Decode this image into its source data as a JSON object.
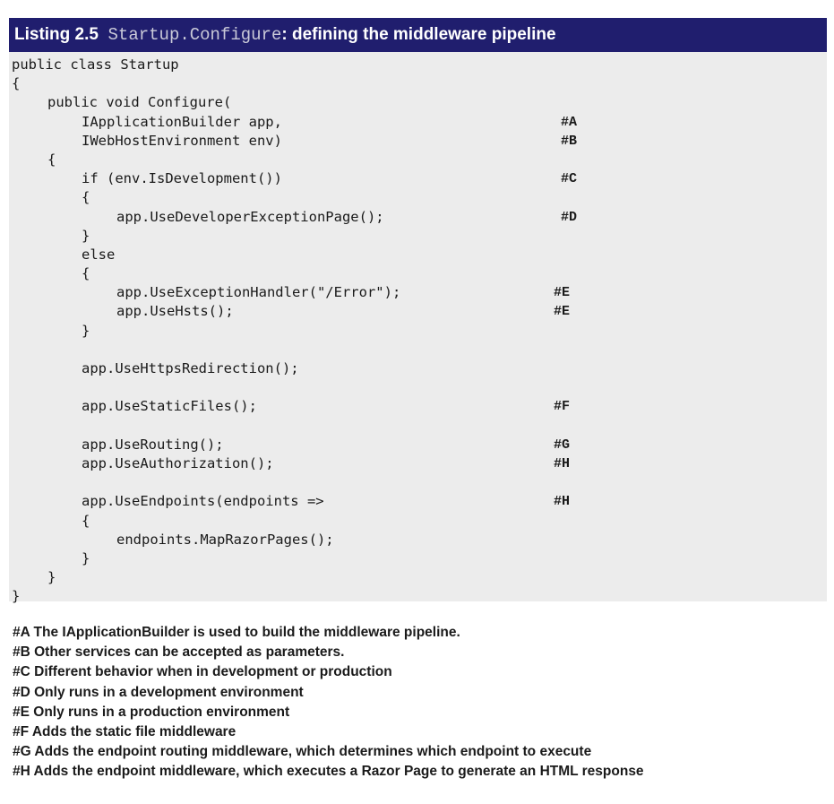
{
  "listing": {
    "label": "Listing 2.5",
    "code_name": "Startup.Configure",
    "title_rest": ": defining the middleware pipeline"
  },
  "code_lines": [
    {
      "text": "public class Startup",
      "annot": ""
    },
    {
      "text": "{",
      "annot": ""
    },
    {
      "text": "public void Configure(",
      "annot": ""
    },
    {
      "text": "IApplicationBuilder app,",
      "annot": "#A"
    },
    {
      "text": "IWebHostEnvironment env)",
      "annot": "#B"
    },
    {
      "text": "{",
      "annot": ""
    },
    {
      "text": "if (env.IsDevelopment())",
      "annot": "#C"
    },
    {
      "text": "{",
      "annot": ""
    },
    {
      "text": "app.UseDeveloperExceptionPage();",
      "annot": "#D"
    },
    {
      "text": "}",
      "annot": ""
    },
    {
      "text": "else",
      "annot": ""
    },
    {
      "text": "{",
      "annot": ""
    },
    {
      "text": "app.UseExceptionHandler(\"/Error\");",
      "annot": "#E"
    },
    {
      "text": "app.UseHsts();",
      "annot": "#E"
    },
    {
      "text": "}",
      "annot": ""
    },
    {
      "text": "",
      "annot": ""
    },
    {
      "text": "app.UseHttpsRedirection();",
      "annot": ""
    },
    {
      "text": "",
      "annot": ""
    },
    {
      "text": "app.UseStaticFiles();",
      "annot": "#F"
    },
    {
      "text": "",
      "annot": ""
    },
    {
      "text": "app.UseRouting();",
      "annot": "#G"
    },
    {
      "text": "app.UseAuthorization();",
      "annot": "#H"
    },
    {
      "text": "",
      "annot": ""
    },
    {
      "text": "app.UseEndpoints(endpoints =>",
      "annot": "#H"
    },
    {
      "text": "{",
      "annot": ""
    },
    {
      "text": "endpoints.MapRazorPages();",
      "annot": ""
    },
    {
      "text": "}",
      "annot": ""
    },
    {
      "text": "}",
      "annot": ""
    },
    {
      "text": "}",
      "annot": ""
    }
  ],
  "notes": [
    "#A The IApplicationBuilder is used to build the middleware pipeline.",
    "#B Other services can be accepted as parameters.",
    "#C Different behavior when in development or production",
    "#D Only runs in a development environment",
    "#E Only runs in a production environment",
    "#F Adds the static file middleware",
    "#G Adds the endpoint routing middleware, which determines which endpoint to execute",
    "#H Adds the endpoint middleware, which executes a Razor Page to generate an HTML response"
  ]
}
